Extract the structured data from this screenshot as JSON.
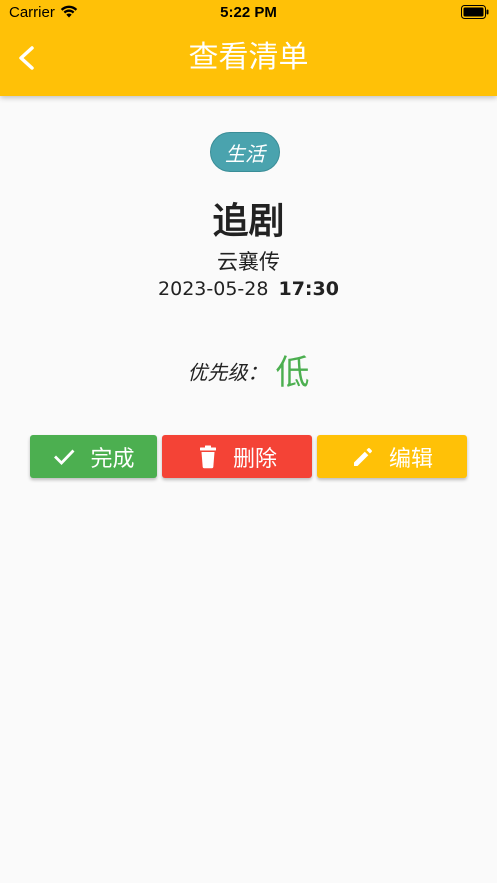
{
  "status_bar": {
    "carrier": "Carrier",
    "time": "5:22 PM"
  },
  "app_bar": {
    "title": "查看清单",
    "back_icon": "chevron-left-icon",
    "color": "#ffc107"
  },
  "task": {
    "category": "生活",
    "title": "追剧",
    "subtitle": "云襄传",
    "date": "2023-05-28",
    "time": "17:30",
    "priority_label": "优先级：",
    "priority_value": "低",
    "priority_color": "#4caf50"
  },
  "actions": {
    "done": {
      "label": "完成",
      "icon": "check-icon",
      "color": "#4caf50"
    },
    "delete": {
      "label": "删除",
      "icon": "trash-icon",
      "color": "#f44336"
    },
    "edit": {
      "label": "编辑",
      "icon": "pencil-icon",
      "color": "#ffc107"
    }
  }
}
